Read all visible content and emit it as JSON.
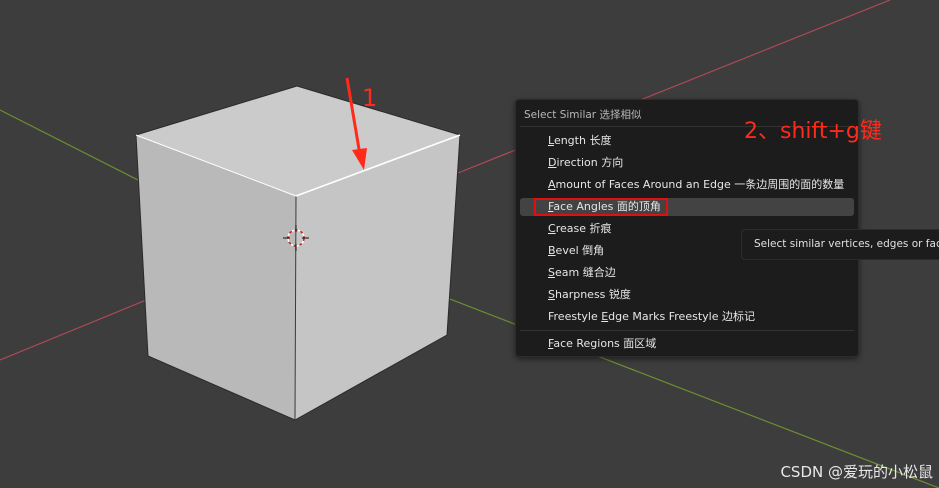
{
  "menu": {
    "title": "Select Similar 选择相似",
    "items": [
      {
        "mnemonic": "L",
        "rest": "ength 长度"
      },
      {
        "mnemonic": "D",
        "rest": "irection 方向"
      },
      {
        "mnemonic": "A",
        "rest": "mount of Faces Around an Edge 一条边周围的面的数量"
      },
      {
        "mnemonic": "F",
        "rest": "ace Angles 面的顶角"
      },
      {
        "mnemonic": "C",
        "rest": "rease 折痕"
      },
      {
        "mnemonic": "B",
        "rest": "evel 倒角"
      },
      {
        "mnemonic": "S",
        "rest": "eam 缝合边"
      },
      {
        "mnemonic": "S",
        "rest": "harpness 锐度"
      },
      {
        "prefix": "Freestyle ",
        "mnemonic": "E",
        "rest": "dge Marks Freestyle 边标记"
      },
      {
        "mnemonic": "F",
        "rest": "ace Regions 面区域"
      }
    ],
    "highlighted_index": 3
  },
  "tooltip": {
    "text": "Select similar vertices, edges or faces by property types"
  },
  "annotations": {
    "step1": "1",
    "step2": "2、shift+g键",
    "color": "#ff2a1a"
  },
  "watermark": "CSDN @爱玩的小松鼠",
  "colors": {
    "background": "#3d3d3d",
    "x_axis": "#b04a55",
    "y_axis": "#6a8f32",
    "cube_top": "#c8c8c8",
    "cube_left": "#b5b5b5",
    "cube_front": "#c2c2c2",
    "menu_bg": "#1c1c1c",
    "highlight_box": "#e01010"
  }
}
